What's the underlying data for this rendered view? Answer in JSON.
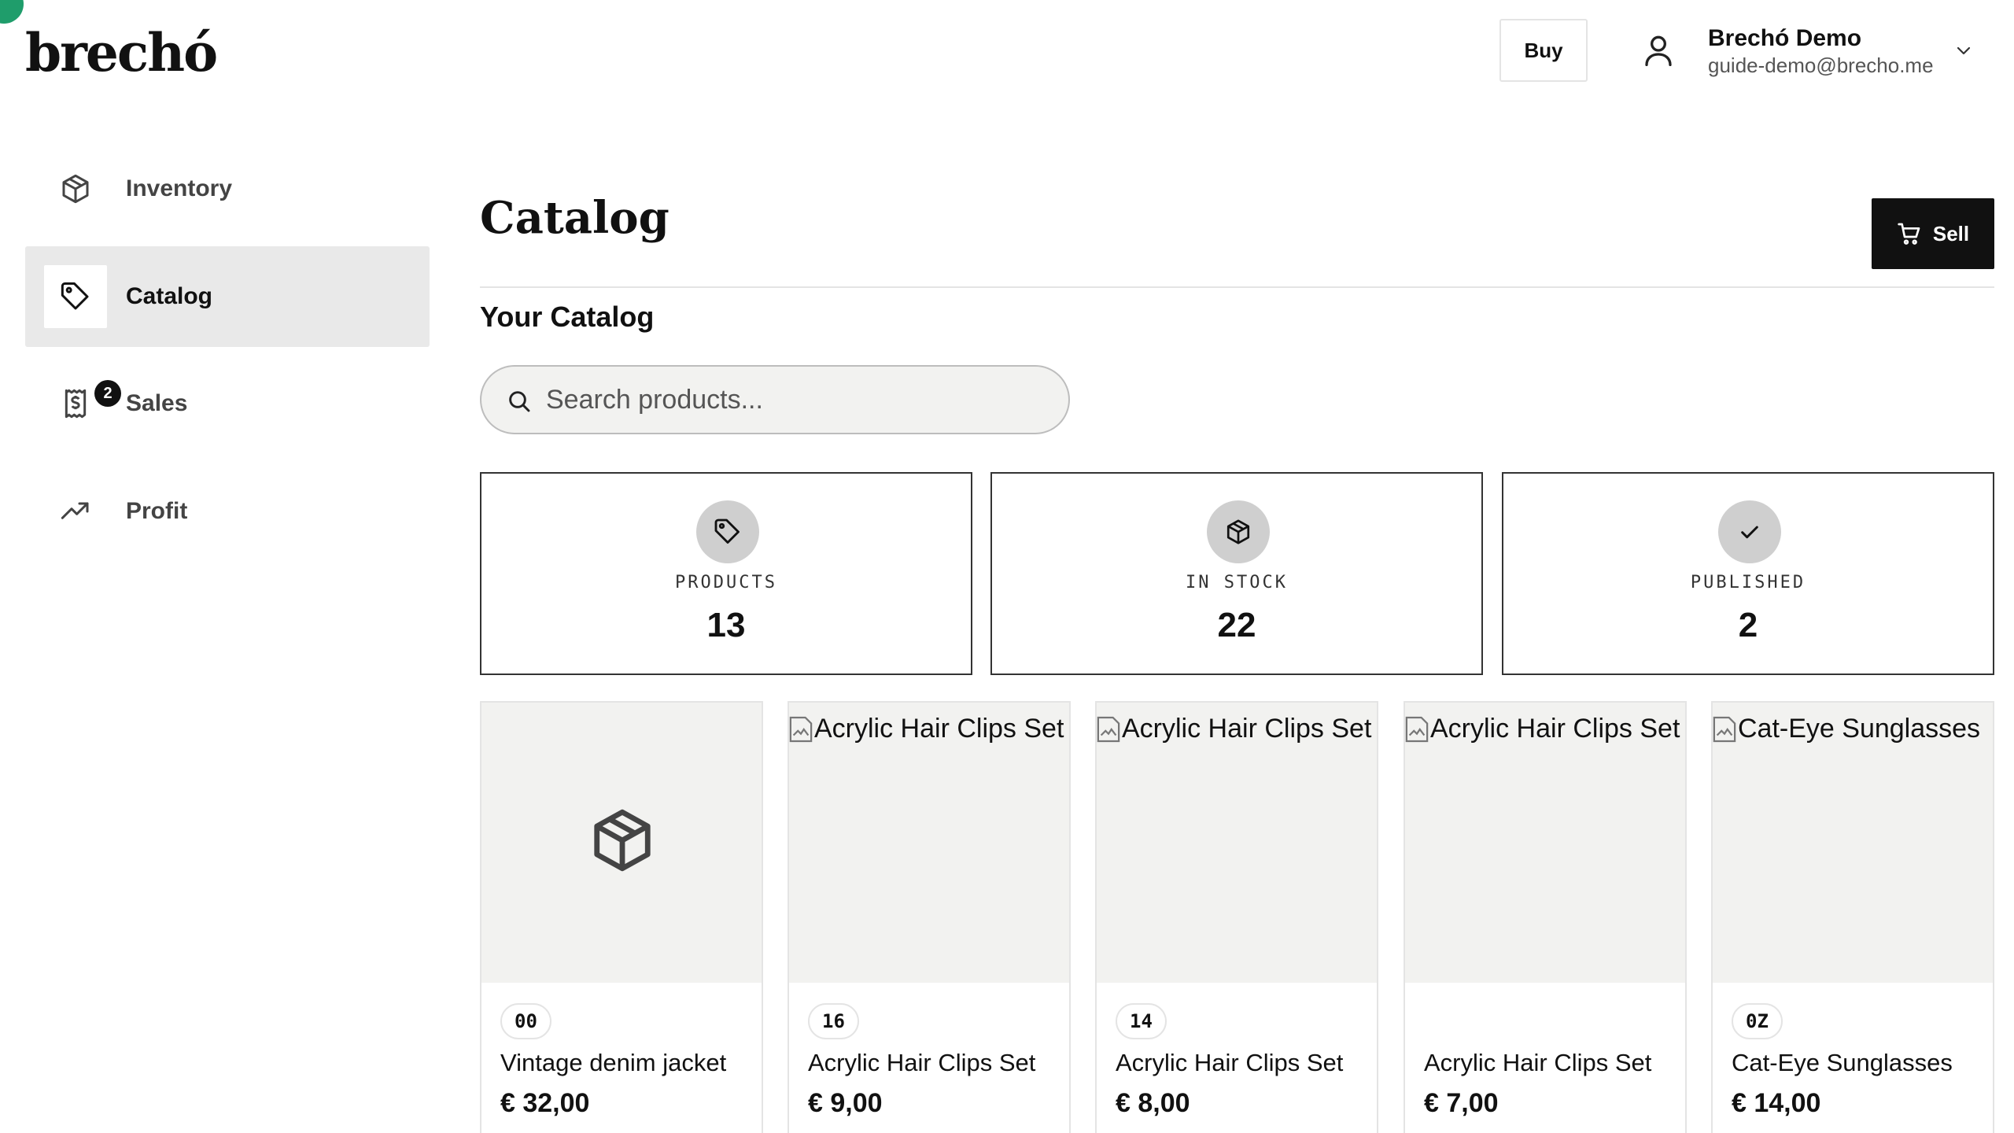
{
  "header": {
    "logo": "brechó",
    "buy_label": "Buy",
    "user_name": "Brechó Demo",
    "user_email": "guide-demo@brecho.me"
  },
  "sidebar": {
    "items": [
      {
        "label": "Inventory",
        "icon": "box-icon",
        "active": false
      },
      {
        "label": "Catalog",
        "icon": "tag-icon",
        "active": true
      },
      {
        "label": "Sales",
        "icon": "receipt-icon",
        "active": false,
        "badge": "2"
      },
      {
        "label": "Profit",
        "icon": "trending-up-icon",
        "active": false
      }
    ]
  },
  "main": {
    "title": "Catalog",
    "sell_label": "Sell",
    "section_title": "Your Catalog",
    "search_placeholder": "Search products...",
    "stats": [
      {
        "label": "PRODUCTS",
        "value": "13",
        "icon": "tag-icon"
      },
      {
        "label": "IN STOCK",
        "value": "22",
        "icon": "box-icon"
      },
      {
        "label": "PUBLISHED",
        "value": "2",
        "icon": "check-icon"
      }
    ],
    "products": [
      {
        "image_alt": "",
        "code": "00",
        "name": "Vintage denim jacket",
        "price": "€ 32,00"
      },
      {
        "image_alt": "Acrylic Hair Clips Set",
        "code": "16",
        "name": "Acrylic Hair Clips Set",
        "price": "€ 9,00"
      },
      {
        "image_alt": "Acrylic Hair Clips Set",
        "code": "14",
        "name": "Acrylic Hair Clips Set",
        "price": "€ 8,00"
      },
      {
        "image_alt": "Acrylic Hair Clips Set",
        "code": "",
        "name": "Acrylic Hair Clips Set",
        "price": "€ 7,00"
      },
      {
        "image_alt": "Cat-Eye Sunglasses",
        "code": "0Z",
        "name": "Cat-Eye Sunglasses",
        "price": "€ 14,00"
      }
    ]
  },
  "colors": {
    "accent_dark": "#111111",
    "active_bg": "#e9e9e9",
    "card_image_bg": "#f2f2f0",
    "corner_dot": "#1f9d6b"
  }
}
